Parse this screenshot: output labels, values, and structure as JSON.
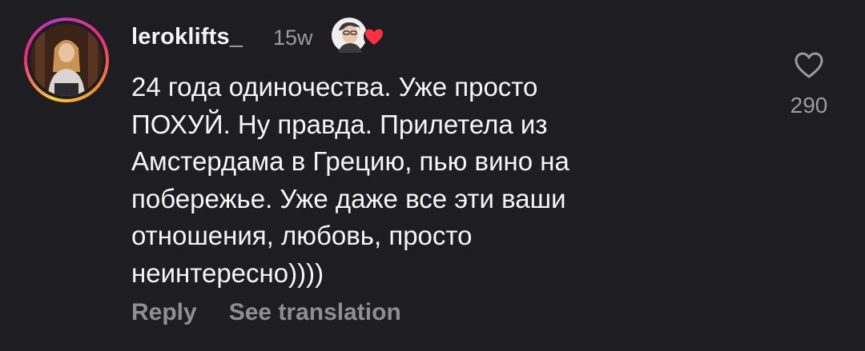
{
  "comment": {
    "username": "leroklifts_",
    "time_ago": "15w",
    "text_lines": [
      "24 года одиночества. Уже просто",
      "ПОХУЙ. Ну правда. Прилетела из",
      "Амстердама в Грецию, пью вино на",
      "побережье. Уже даже все эти ваши",
      "отношения, любовь, просто",
      "неинтересно))))"
    ],
    "reply_label": "Reply",
    "translate_label": "See translation",
    "like_count": "290",
    "liked_by_creator": true
  },
  "colors": {
    "background": "#1e1d22",
    "text": "#f5f5f5",
    "muted": "#8e8e93",
    "heart_red": "#ff3040"
  },
  "icons": {
    "like": "heart-outline-icon",
    "creator_like": "red-heart-icon"
  }
}
